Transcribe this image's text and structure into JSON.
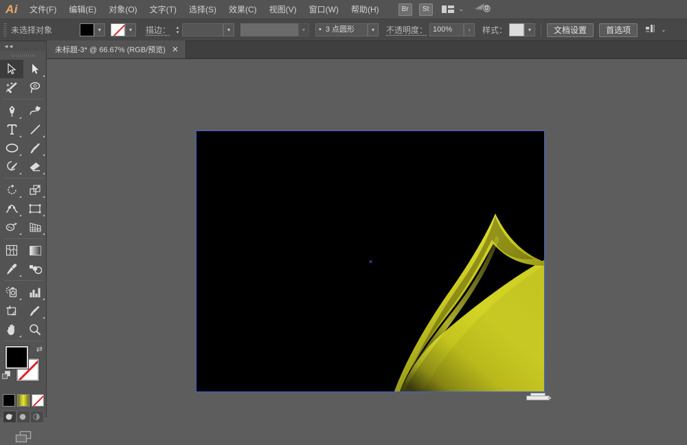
{
  "app": {
    "logo": "Ai",
    "brand_color": "#f0a868"
  },
  "menubar": {
    "items": [
      {
        "label": "文件(F)",
        "name": "menu-file"
      },
      {
        "label": "编辑(E)",
        "name": "menu-edit"
      },
      {
        "label": "对象(O)",
        "name": "menu-object"
      },
      {
        "label": "文字(T)",
        "name": "menu-type"
      },
      {
        "label": "选择(S)",
        "name": "menu-select"
      },
      {
        "label": "效果(C)",
        "name": "menu-effect"
      },
      {
        "label": "视图(V)",
        "name": "menu-view"
      },
      {
        "label": "窗口(W)",
        "name": "menu-window"
      },
      {
        "label": "帮助(H)",
        "name": "menu-help"
      }
    ],
    "bridge_button": "Br",
    "stock_button": "St",
    "workspace_icon": "workspace-layout-icon",
    "workspace_chevron": "⌄",
    "cloud_icon": "cloud-sync-icon"
  },
  "controlbar": {
    "selection_status": "未选择对象",
    "fill_label": "fill-swatch",
    "fill_color": "#000000",
    "stroke_swatch_label": "stroke-swatch-none",
    "stroke_label": "描边：",
    "stroke_weight_value": "",
    "stroke_profile_value": "",
    "brush_value": "3 点圆形",
    "brush_bullet": "•",
    "opacity_label": "不透明度：",
    "opacity_value": "100%",
    "opacity_more": "›",
    "style_label": "样式：",
    "style_swatch": "style-swatch",
    "doc_setup_button": "文档设置",
    "preferences_button": "首选项",
    "align_icon": "align-objects-icon",
    "align_chevron": "⌄"
  },
  "tabbar": {
    "tab_title": "未标题-3* @ 66.67% (RGB/预览)",
    "tab_close": "✕"
  },
  "toolpanel": {
    "collapse_icon": "◄◄",
    "tools": [
      {
        "name": "selection-tool",
        "active": true,
        "corner": false
      },
      {
        "name": "direct-selection-tool",
        "active": false,
        "corner": true
      },
      {
        "name": "magic-wand-tool",
        "active": false,
        "corner": false
      },
      {
        "name": "lasso-tool",
        "active": false,
        "corner": false
      },
      {
        "name": "pen-tool",
        "active": false,
        "corner": true
      },
      {
        "name": "curvature-tool",
        "active": false,
        "corner": false
      },
      {
        "name": "type-tool",
        "active": false,
        "corner": true
      },
      {
        "name": "line-segment-tool",
        "active": false,
        "corner": true
      },
      {
        "name": "ellipse-tool",
        "active": false,
        "corner": true
      },
      {
        "name": "paintbrush-tool",
        "active": false,
        "corner": true
      },
      {
        "name": "shaper-pencil-tool",
        "active": false,
        "corner": true
      },
      {
        "name": "eraser-tool",
        "active": false,
        "corner": true
      },
      {
        "name": "rotate-tool",
        "active": false,
        "corner": true
      },
      {
        "name": "scale-tool",
        "active": false,
        "corner": true
      },
      {
        "name": "width-tool",
        "active": false,
        "corner": true
      },
      {
        "name": "free-transform-tool",
        "active": false,
        "corner": true
      },
      {
        "name": "shape-builder-tool",
        "active": false,
        "corner": true
      },
      {
        "name": "perspective-grid-tool",
        "active": false,
        "corner": true
      },
      {
        "name": "mesh-tool",
        "active": false,
        "corner": false
      },
      {
        "name": "gradient-tool",
        "active": false,
        "corner": false
      },
      {
        "name": "eyedropper-tool",
        "active": false,
        "corner": true
      },
      {
        "name": "blend-tool",
        "active": false,
        "corner": false
      },
      {
        "name": "symbol-sprayer-tool",
        "active": false,
        "corner": true
      },
      {
        "name": "column-graph-tool",
        "active": false,
        "corner": true
      },
      {
        "name": "artboard-tool",
        "active": false,
        "corner": false
      },
      {
        "name": "slice-tool",
        "active": false,
        "corner": true
      },
      {
        "name": "hand-tool",
        "active": false,
        "corner": true
      },
      {
        "name": "zoom-tool",
        "active": false,
        "corner": false
      }
    ],
    "fill_color": "#000000",
    "stroke_color": "none",
    "swap_icon": "swap-fill-stroke-icon",
    "default_icon": "default-fill-stroke-icon",
    "mode_color_name": "color-swatch",
    "mode_gradient_name": "gradient-swatch",
    "mode_none_name": "none-swatch",
    "gradient_color_a": "#6d6d1a",
    "gradient_color_b": "#e8e83a",
    "draw_modes": [
      "draw-normal",
      "draw-behind",
      "draw-inside"
    ],
    "screen_mode": "screen-mode-icon"
  },
  "canvas": {
    "background": "#5d5d5d",
    "artboard_background": "#000000",
    "artboard_border_color": "#3c63d8",
    "center_mark": "✕",
    "artboard_handle": "artboard-resize-handle",
    "artwork_name": "yellow-blend-curve-artwork",
    "artwork_colors": {
      "highlight": "#eaea3c",
      "mid": "#c8c81e",
      "shadow": "#5e5e12",
      "deep": "#2a2a08"
    }
  }
}
